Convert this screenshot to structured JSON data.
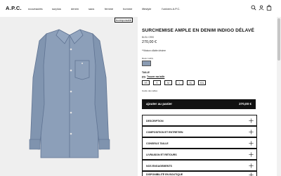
{
  "brand": {
    "logo": "A.P.C."
  },
  "nav": {
    "items": [
      "nouveautés",
      "surplus",
      "denim",
      "sacs",
      "femme",
      "homme",
      "lifestyle",
      "l'univers A.P.C."
    ]
  },
  "header_icons": [
    "search-icon",
    "user-icon",
    "bag-icon"
  ],
  "gallery": {
    "badge": "écoresponsable"
  },
  "product": {
    "title": "SURCHEMISE AMPLE EN DENIM INDIGO DÉLAVÉ",
    "color_name": "BLEU GRIS",
    "price": "270,00 €",
    "note": "**Maison cillatte désiree",
    "color_label": "BLEU GRIS",
    "swatch_color": "#8a9bb2",
    "size_label": "TAILLE",
    "size_guide": "Trouver ma taille",
    "sizes": [
      "XS",
      "S",
      "M",
      "L",
      "XL",
      "XXL"
    ],
    "size_subnote": "Guide des tailles",
    "add_to_cart": "ajouter au panier",
    "cart_price": "270,00 €"
  },
  "accordion": [
    {
      "label": "DESCRIPTION"
    },
    {
      "label": "COMPOSITION ET ENTRETIEN"
    },
    {
      "label": "CONSEILS TAILLE"
    },
    {
      "label": "LIVRAISON ET RETOURS"
    },
    {
      "label": "NOS ENGAGEMENTS"
    },
    {
      "label": "DISPONIBILITÉ EN BOUTIQUE"
    }
  ]
}
